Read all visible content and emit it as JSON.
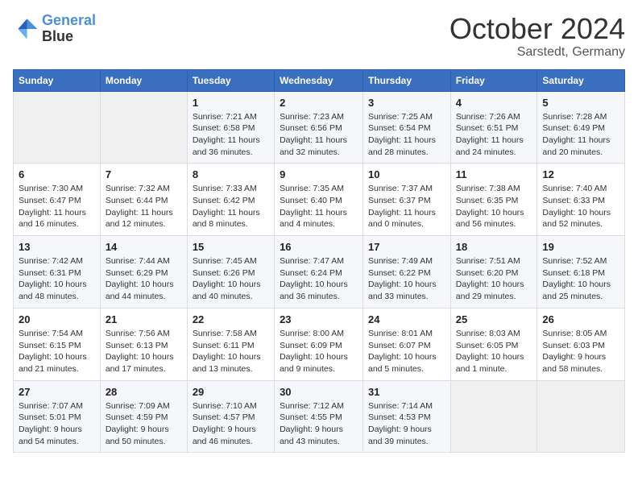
{
  "header": {
    "logo_line1": "General",
    "logo_line2": "Blue",
    "month": "October 2024",
    "location": "Sarstedt, Germany"
  },
  "weekdays": [
    "Sunday",
    "Monday",
    "Tuesday",
    "Wednesday",
    "Thursday",
    "Friday",
    "Saturday"
  ],
  "weeks": [
    [
      {
        "day": "",
        "info": ""
      },
      {
        "day": "",
        "info": ""
      },
      {
        "day": "1",
        "info": "Sunrise: 7:21 AM\nSunset: 6:58 PM\nDaylight: 11 hours and 36 minutes."
      },
      {
        "day": "2",
        "info": "Sunrise: 7:23 AM\nSunset: 6:56 PM\nDaylight: 11 hours and 32 minutes."
      },
      {
        "day": "3",
        "info": "Sunrise: 7:25 AM\nSunset: 6:54 PM\nDaylight: 11 hours and 28 minutes."
      },
      {
        "day": "4",
        "info": "Sunrise: 7:26 AM\nSunset: 6:51 PM\nDaylight: 11 hours and 24 minutes."
      },
      {
        "day": "5",
        "info": "Sunrise: 7:28 AM\nSunset: 6:49 PM\nDaylight: 11 hours and 20 minutes."
      }
    ],
    [
      {
        "day": "6",
        "info": "Sunrise: 7:30 AM\nSunset: 6:47 PM\nDaylight: 11 hours and 16 minutes."
      },
      {
        "day": "7",
        "info": "Sunrise: 7:32 AM\nSunset: 6:44 PM\nDaylight: 11 hours and 12 minutes."
      },
      {
        "day": "8",
        "info": "Sunrise: 7:33 AM\nSunset: 6:42 PM\nDaylight: 11 hours and 8 minutes."
      },
      {
        "day": "9",
        "info": "Sunrise: 7:35 AM\nSunset: 6:40 PM\nDaylight: 11 hours and 4 minutes."
      },
      {
        "day": "10",
        "info": "Sunrise: 7:37 AM\nSunset: 6:37 PM\nDaylight: 11 hours and 0 minutes."
      },
      {
        "day": "11",
        "info": "Sunrise: 7:38 AM\nSunset: 6:35 PM\nDaylight: 10 hours and 56 minutes."
      },
      {
        "day": "12",
        "info": "Sunrise: 7:40 AM\nSunset: 6:33 PM\nDaylight: 10 hours and 52 minutes."
      }
    ],
    [
      {
        "day": "13",
        "info": "Sunrise: 7:42 AM\nSunset: 6:31 PM\nDaylight: 10 hours and 48 minutes."
      },
      {
        "day": "14",
        "info": "Sunrise: 7:44 AM\nSunset: 6:29 PM\nDaylight: 10 hours and 44 minutes."
      },
      {
        "day": "15",
        "info": "Sunrise: 7:45 AM\nSunset: 6:26 PM\nDaylight: 10 hours and 40 minutes."
      },
      {
        "day": "16",
        "info": "Sunrise: 7:47 AM\nSunset: 6:24 PM\nDaylight: 10 hours and 36 minutes."
      },
      {
        "day": "17",
        "info": "Sunrise: 7:49 AM\nSunset: 6:22 PM\nDaylight: 10 hours and 33 minutes."
      },
      {
        "day": "18",
        "info": "Sunrise: 7:51 AM\nSunset: 6:20 PM\nDaylight: 10 hours and 29 minutes."
      },
      {
        "day": "19",
        "info": "Sunrise: 7:52 AM\nSunset: 6:18 PM\nDaylight: 10 hours and 25 minutes."
      }
    ],
    [
      {
        "day": "20",
        "info": "Sunrise: 7:54 AM\nSunset: 6:15 PM\nDaylight: 10 hours and 21 minutes."
      },
      {
        "day": "21",
        "info": "Sunrise: 7:56 AM\nSunset: 6:13 PM\nDaylight: 10 hours and 17 minutes."
      },
      {
        "day": "22",
        "info": "Sunrise: 7:58 AM\nSunset: 6:11 PM\nDaylight: 10 hours and 13 minutes."
      },
      {
        "day": "23",
        "info": "Sunrise: 8:00 AM\nSunset: 6:09 PM\nDaylight: 10 hours and 9 minutes."
      },
      {
        "day": "24",
        "info": "Sunrise: 8:01 AM\nSunset: 6:07 PM\nDaylight: 10 hours and 5 minutes."
      },
      {
        "day": "25",
        "info": "Sunrise: 8:03 AM\nSunset: 6:05 PM\nDaylight: 10 hours and 1 minute."
      },
      {
        "day": "26",
        "info": "Sunrise: 8:05 AM\nSunset: 6:03 PM\nDaylight: 9 hours and 58 minutes."
      }
    ],
    [
      {
        "day": "27",
        "info": "Sunrise: 7:07 AM\nSunset: 5:01 PM\nDaylight: 9 hours and 54 minutes."
      },
      {
        "day": "28",
        "info": "Sunrise: 7:09 AM\nSunset: 4:59 PM\nDaylight: 9 hours and 50 minutes."
      },
      {
        "day": "29",
        "info": "Sunrise: 7:10 AM\nSunset: 4:57 PM\nDaylight: 9 hours and 46 minutes."
      },
      {
        "day": "30",
        "info": "Sunrise: 7:12 AM\nSunset: 4:55 PM\nDaylight: 9 hours and 43 minutes."
      },
      {
        "day": "31",
        "info": "Sunrise: 7:14 AM\nSunset: 4:53 PM\nDaylight: 9 hours and 39 minutes."
      },
      {
        "day": "",
        "info": ""
      },
      {
        "day": "",
        "info": ""
      }
    ]
  ]
}
